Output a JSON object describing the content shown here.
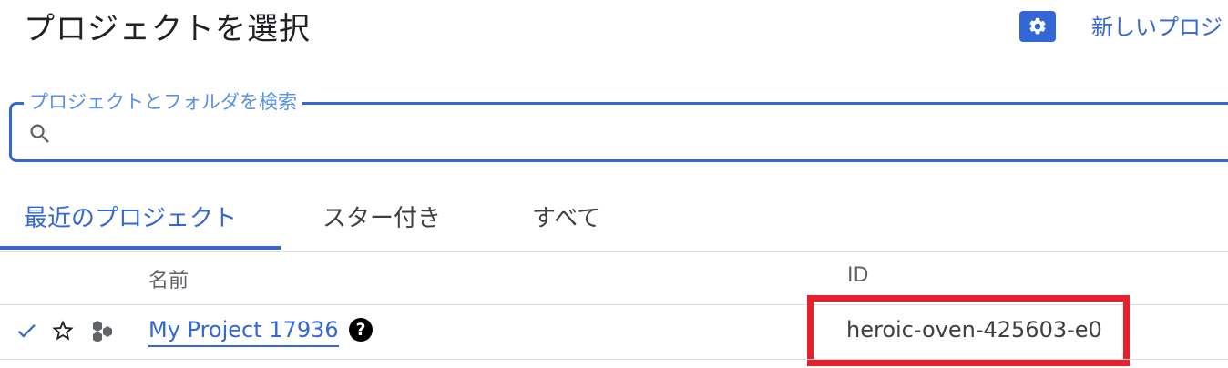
{
  "header": {
    "title": "プロジェクトを選択",
    "manage_icon": "gear-icon",
    "new_project_label": "新しいプロジ"
  },
  "search": {
    "label": "プロジェクトとフォルダを検索",
    "value": "",
    "icon": "search-icon"
  },
  "tabs": [
    {
      "label": "最近のプロジェクト",
      "active": true
    },
    {
      "label": "スター付き",
      "active": false
    },
    {
      "label": "すべて",
      "active": false
    }
  ],
  "table": {
    "columns": {
      "name": "名前",
      "id": "ID"
    },
    "rows": [
      {
        "selected_icon": "check-icon",
        "star_icon": "star-outline-icon",
        "type_icon": "project-hexagons-icon",
        "name": "My Project 17936",
        "help_icon_label": "?",
        "id": "heroic-oven-425603-e0"
      }
    ]
  },
  "colors": {
    "accent": "#3367d6",
    "highlight_box": "#e8202b",
    "text_primary": "#202124",
    "text_secondary": "#5f6368"
  }
}
